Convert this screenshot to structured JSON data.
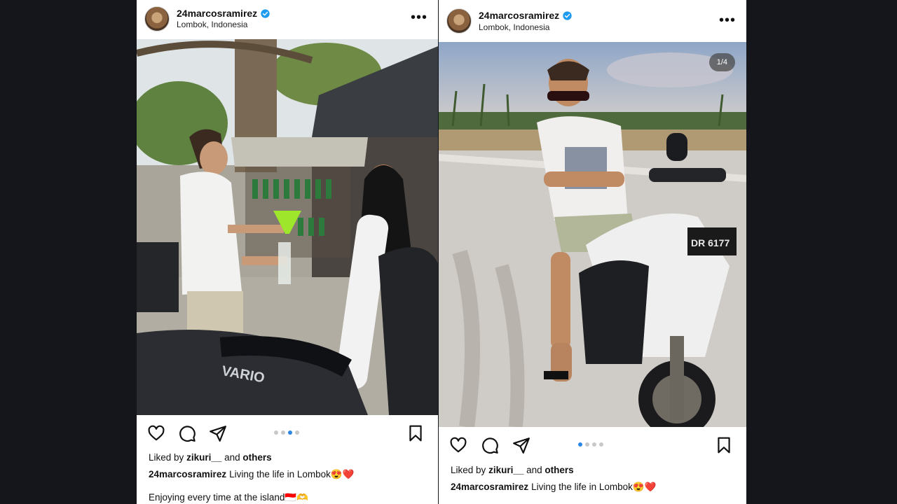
{
  "posts": [
    {
      "username": "24marcosramirez",
      "location": "Lombok, Indonesia",
      "more_label": "•••",
      "carousel": {
        "count": 4,
        "active": 3
      },
      "likes": {
        "prefix": "Liked by",
        "user": "zikuri__",
        "mid": "and",
        "others": "others"
      },
      "caption": {
        "user": "24marcosramirez",
        "text": "Living the life in Lombok😍❤️"
      },
      "extra_text": "Enjoying every time at the island🇮🇩🫶"
    },
    {
      "username": "24marcosramirez",
      "location": "Lombok, Indonesia",
      "more_label": "•••",
      "counter": "1/4",
      "carousel": {
        "count": 4,
        "active": 1
      },
      "likes": {
        "prefix": "Liked by",
        "user": "zikuri__",
        "mid": "and",
        "others": "others"
      },
      "caption": {
        "user": "24marcosramirez",
        "text": "Living the life in Lombok😍❤️"
      }
    }
  ],
  "icons": [
    "heart-icon",
    "comment-icon",
    "share-icon",
    "bookmark-icon",
    "verified-icon",
    "more-icon"
  ],
  "colors": {
    "verified": "#1d9bf0",
    "active_dot": "#2c86e6",
    "background": "#15151c"
  }
}
